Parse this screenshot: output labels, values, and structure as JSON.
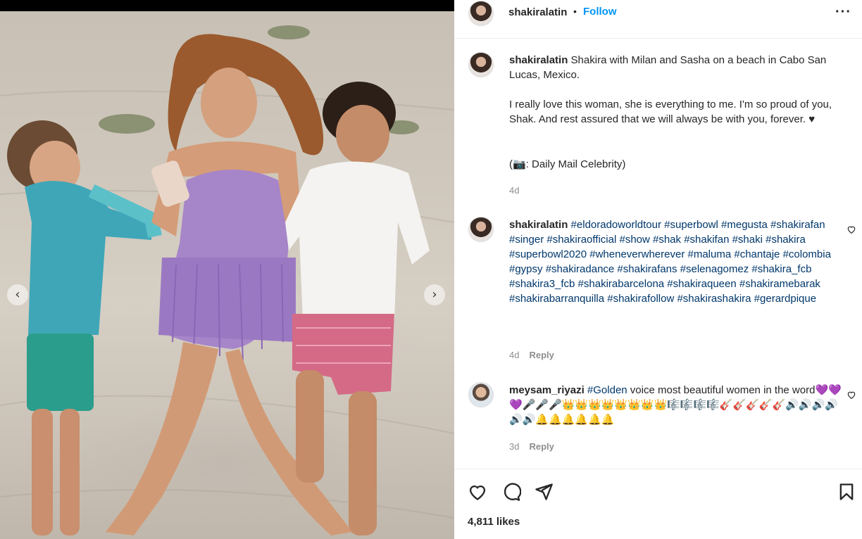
{
  "post": {
    "username": "shakiralatin",
    "follow_label": "Follow",
    "more_icon": "more-options-icon",
    "likes": "4,811 likes"
  },
  "caption": {
    "username": "shakiralatin",
    "line1": "Shakira with Milan and Sasha on a beach in Cabo San Lucas, Mexico.",
    "line2": "I really love this woman, she is everything to me. I'm so proud of you, Shak. And rest assured that we will always be with you, forever. ♥",
    "line3": "(📷: Daily Mail Celebrity)",
    "time": "4d"
  },
  "comments": [
    {
      "username": "shakiralatin",
      "text": "#eldoradoworldtour #superbowl #megusta #shakirafan #singer #shakiraofficial #show #shak #shakifan #shaki #shakira #superbowl2020 #wheneverwherever #maluma #chantaje #colombia #gypsy #shakiradance #shakirafans #selenagomez #shakira_fcb #shakira3_fcb #shakirabarcelona #shakiraqueen #shakiramebarak #shakirabarranquilla #shakirafollow #shakirashakira #gerardpique",
      "time": "4d",
      "reply": "Reply"
    },
    {
      "username": "meysam_riyazi",
      "text_tag": "#Golden",
      "text": " voice most beautiful women in the word💜💜💜🎤🎤🎤👑👑👑👑👑👑👑👑🎼🎼🎼🎼🎸🎸🎸🎸🎸🔊🔊🔊🔊🔊🔊🔔🔔🔔🔔🔔🔔",
      "time": "3d",
      "reply": "Reply"
    }
  ],
  "colors": {
    "link": "#0095f6",
    "hashtag": "#00376b",
    "secondary": "#8e8e8e"
  }
}
